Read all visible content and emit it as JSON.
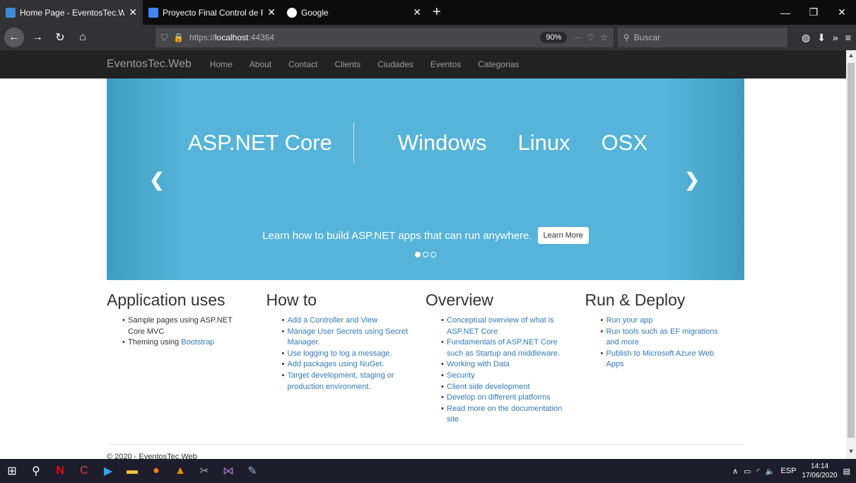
{
  "browser": {
    "tabs": [
      {
        "title": "Home Page - EventosTec.Web",
        "active": true,
        "favicon_color": "#3c8ad8"
      },
      {
        "title": "Proyecto Final Control de Rese",
        "active": false,
        "favicon_color": "#4285f4"
      },
      {
        "title": "Google",
        "active": false,
        "favicon_color": "#ffffff"
      }
    ],
    "url_prefix": "https://",
    "url_host": "localhost",
    "url_port": ":44364",
    "zoom": "90%",
    "search_placeholder": "Buscar",
    "window_controls": [
      "minimize-icon",
      "restore-icon",
      "close-icon"
    ]
  },
  "site": {
    "brand": "EventosTec.Web",
    "nav": [
      "Home",
      "About",
      "Contact",
      "Clients",
      "Ciudades",
      "Eventos",
      "Categorias"
    ]
  },
  "carousel": {
    "core": "ASP.NET Core",
    "platforms": [
      "Windows",
      "Linux",
      "OSX"
    ],
    "caption": "Learn how to build ASP.NET apps that can run anywhere.",
    "button": "Learn More",
    "active_slide": 0,
    "slide_count": 3
  },
  "columns": [
    {
      "title": "Application uses",
      "items": [
        {
          "text": "Sample pages using ASP.NET Core MVC",
          "link": false
        },
        {
          "text": "Theming using ",
          "link_text": "Bootstrap",
          "link": "partial"
        }
      ]
    },
    {
      "title": "How to",
      "items": [
        {
          "text": "Add a Controller and View",
          "link": true
        },
        {
          "text": "Manage User Secrets using Secret Manager.",
          "link": true
        },
        {
          "text": "Use logging to log a message.",
          "link": true
        },
        {
          "text": "Add packages using NuGet.",
          "link": true
        },
        {
          "text": "Target development, staging or production environment.",
          "link": true
        }
      ]
    },
    {
      "title": "Overview",
      "items": [
        {
          "text": "Conceptual overview of what is ASP.NET Core",
          "link": true
        },
        {
          "text": "Fundamentals of ASP.NET Core such as Startup and middleware.",
          "link": true
        },
        {
          "text": "Working with Data",
          "link": true
        },
        {
          "text": "Security",
          "link": true
        },
        {
          "text": "Client side development",
          "link": true
        },
        {
          "text": "Develop on different platforms",
          "link": true
        },
        {
          "text": "Read more on the documentation site",
          "link": true
        }
      ]
    },
    {
      "title": "Run & Deploy",
      "items": [
        {
          "text": "Run your app",
          "link": true
        },
        {
          "text": "Run tools such as EF migrations and more",
          "link": true
        },
        {
          "text": "Publish to Microsoft Azure Web Apps",
          "link": true
        }
      ]
    }
  ],
  "footer": "© 2020 - EventosTec.Web",
  "taskbar": {
    "lang": "ESP",
    "time": "14:14",
    "date": "17/06/2020",
    "notifications": "1"
  }
}
